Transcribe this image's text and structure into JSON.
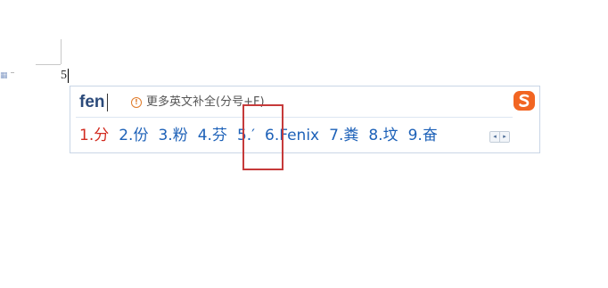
{
  "document": {
    "typed_text": "5"
  },
  "ime": {
    "pinyin_input": "fen",
    "hint_text": "更多英文补全(分号+F)",
    "logo_icon": "sogou-s-icon",
    "candidates": [
      {
        "label": "1.分",
        "selected": true
      },
      {
        "label": "2.份",
        "selected": false
      },
      {
        "label": "3.粉",
        "selected": false
      },
      {
        "label": "4.芬",
        "selected": false
      },
      {
        "label": "5.′",
        "selected": false
      },
      {
        "label": "6.Fenix",
        "selected": false
      },
      {
        "label": "7.粪",
        "selected": false
      },
      {
        "label": "8.坟",
        "selected": false
      },
      {
        "label": "9.奋",
        "selected": false
      }
    ],
    "pager": {
      "prev_icon": "◂",
      "next_icon": "▸"
    }
  },
  "colors": {
    "candidate": "#1d61b8",
    "selected_candidate": "#d22b20",
    "pinyin": "#2b4a7a",
    "highlight_box": "#c63a3a",
    "logo": "#f26522"
  }
}
